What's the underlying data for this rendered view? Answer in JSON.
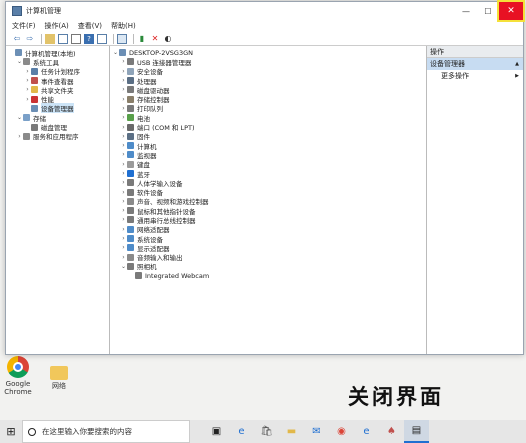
{
  "window": {
    "title": "计算机管理",
    "minimize": "—",
    "maximize": "☐",
    "close": "✕"
  },
  "menu": [
    "文件(F)",
    "操作(A)",
    "查看(V)",
    "帮助(H)"
  ],
  "toolbar_icons": [
    "back-icon",
    "forward-icon",
    "up-folder-icon",
    "show-hide-tree-icon",
    "properties-icon",
    "help-icon",
    "view-icon",
    "update-driver-icon",
    "uninstall-icon",
    "scan-hardware-icon"
  ],
  "left_tree": [
    {
      "label": "计算机管理(本地)",
      "level": 0,
      "exp": "",
      "color": "#6c8fb5"
    },
    {
      "label": "系统工具",
      "level": 1,
      "exp": "⌄",
      "color": "#8a8a8a"
    },
    {
      "label": "任务计划程序",
      "level": 2,
      "exp": "›",
      "color": "#5a7fa8"
    },
    {
      "label": "事件查看器",
      "level": 2,
      "exp": "›",
      "color": "#c0504d"
    },
    {
      "label": "共享文件夹",
      "level": 2,
      "exp": "›",
      "color": "#e2b84a"
    },
    {
      "label": "性能",
      "level": 2,
      "exp": "›",
      "color": "#c33"
    },
    {
      "label": "设备管理器",
      "level": 2,
      "exp": "",
      "color": "#6c8fb5",
      "selected": true
    },
    {
      "label": "存储",
      "level": 1,
      "exp": "⌄",
      "color": "#7aa0c8"
    },
    {
      "label": "磁盘管理",
      "level": 2,
      "exp": "",
      "color": "#7a7a7a"
    },
    {
      "label": "服务和应用程序",
      "level": 1,
      "exp": "›",
      "color": "#8a8a8a"
    }
  ],
  "device_tree": [
    {
      "label": "DESKTOP-2VSG3GN",
      "level": 0,
      "exp": "⌄",
      "color": "#6c8fb5"
    },
    {
      "label": "USB 连接器管理器",
      "level": 1,
      "exp": "›",
      "color": "#7a7a7a"
    },
    {
      "label": "安全设备",
      "level": 1,
      "exp": "›",
      "color": "#8fa4b9"
    },
    {
      "label": "处理器",
      "level": 1,
      "exp": "›",
      "color": "#5b6f85"
    },
    {
      "label": "磁盘驱动器",
      "level": 1,
      "exp": "›",
      "color": "#7a7a7a"
    },
    {
      "label": "存储控制器",
      "level": 1,
      "exp": "›",
      "color": "#8a7f6a"
    },
    {
      "label": "打印队列",
      "level": 1,
      "exp": "›",
      "color": "#7a7a7a"
    },
    {
      "label": "电池",
      "level": 1,
      "exp": "›",
      "color": "#58a04a"
    },
    {
      "label": "端口 (COM 和 LPT)",
      "level": 1,
      "exp": "›",
      "color": "#6a6a6a"
    },
    {
      "label": "固件",
      "level": 1,
      "exp": "›",
      "color": "#5b6f85"
    },
    {
      "label": "计算机",
      "level": 1,
      "exp": "›",
      "color": "#4f8cc9"
    },
    {
      "label": "监视器",
      "level": 1,
      "exp": "›",
      "color": "#4f8cc9"
    },
    {
      "label": "键盘",
      "level": 1,
      "exp": "›",
      "color": "#9a9a9a"
    },
    {
      "label": "蓝牙",
      "level": 1,
      "exp": "›",
      "color": "#1f6fd1"
    },
    {
      "label": "人体学输入设备",
      "level": 1,
      "exp": "›",
      "color": "#7a7a7a"
    },
    {
      "label": "软件设备",
      "level": 1,
      "exp": "›",
      "color": "#7a7a7a"
    },
    {
      "label": "声音、视频和游戏控制器",
      "level": 1,
      "exp": "›",
      "color": "#8a8a8a"
    },
    {
      "label": "鼠标和其他指针设备",
      "level": 1,
      "exp": "›",
      "color": "#7a7a7a"
    },
    {
      "label": "通用串行总线控制器",
      "level": 1,
      "exp": "›",
      "color": "#7a7a7a"
    },
    {
      "label": "网络适配器",
      "level": 1,
      "exp": "›",
      "color": "#4f8cc9"
    },
    {
      "label": "系统设备",
      "level": 1,
      "exp": "›",
      "color": "#4f8cc9"
    },
    {
      "label": "显示适配器",
      "level": 1,
      "exp": "›",
      "color": "#4f8cc9"
    },
    {
      "label": "音频输入和输出",
      "level": 1,
      "exp": "›",
      "color": "#8a8a8a"
    },
    {
      "label": "照相机",
      "level": 1,
      "exp": "⌄",
      "color": "#7a7a7a"
    },
    {
      "label": "Integrated Webcam",
      "level": 2,
      "exp": "",
      "color": "#7a7a7a"
    }
  ],
  "actions": {
    "header": "操作",
    "section": "设备管理器",
    "more": "更多操作",
    "arrow_up": "▲",
    "arrow_right": "▶"
  },
  "desktop": {
    "chrome_label_1": "Google",
    "chrome_label_2": "Chrome",
    "folder_label": "网络",
    "caption": "关闭界面"
  },
  "taskbar": {
    "start": "⊞",
    "search_placeholder": "在这里输入你要搜索的内容",
    "icons": [
      "task-view-icon",
      "edge-icon",
      "store-icon",
      "explorer-icon",
      "mail-icon",
      "chrome-icon",
      "ie-icon",
      "game-icon",
      "computer-management-icon"
    ]
  }
}
